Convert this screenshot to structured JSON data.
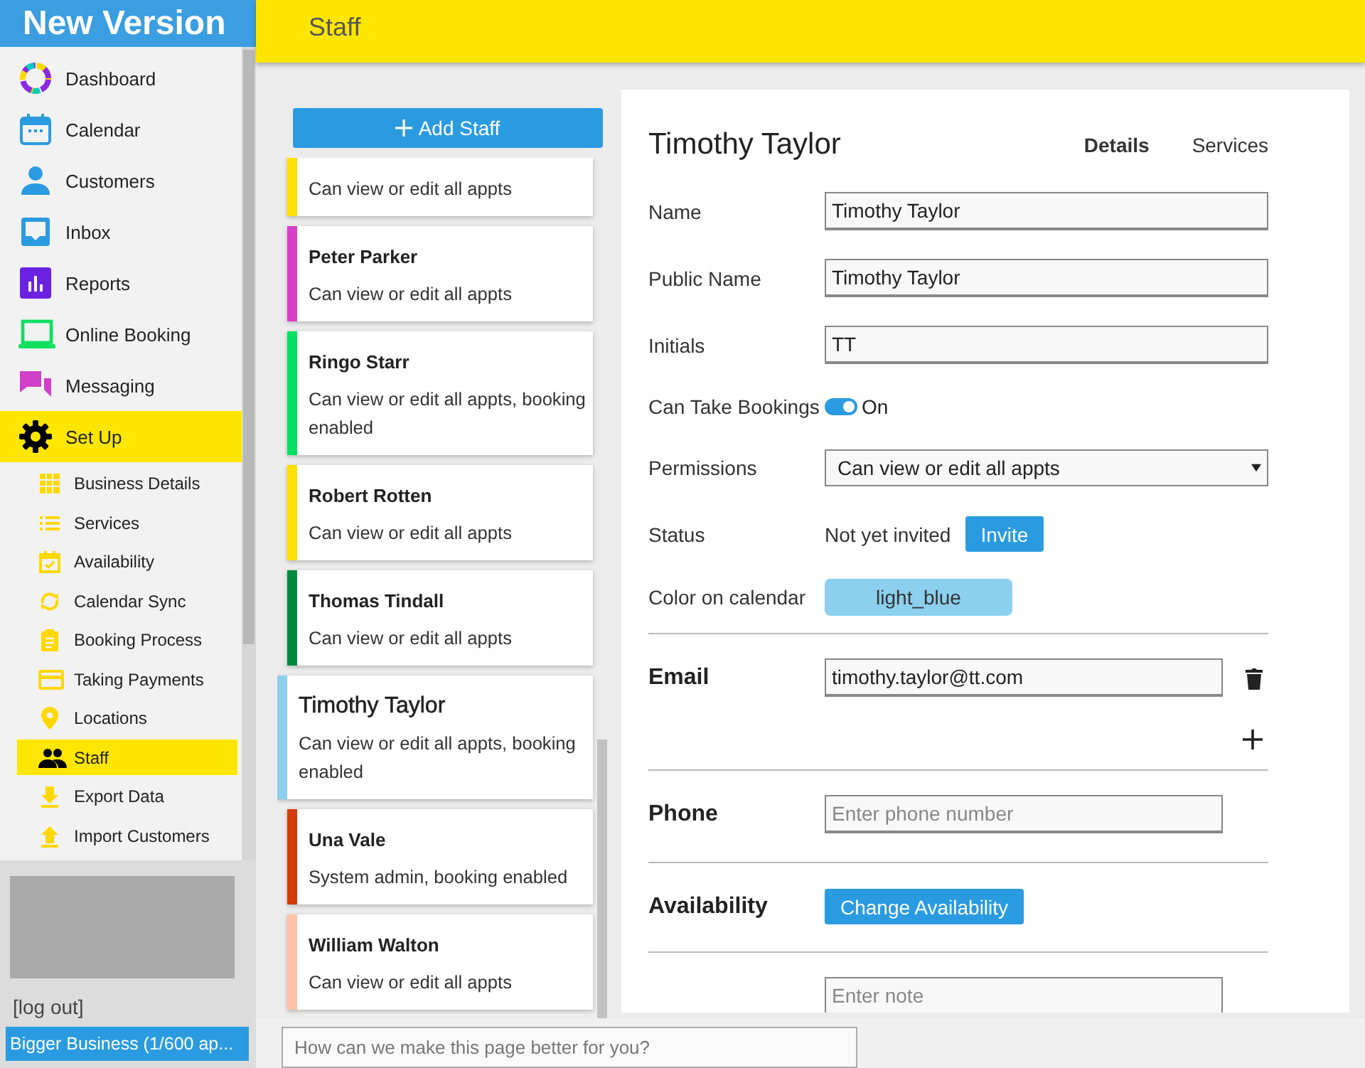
{
  "sidebar": {
    "brand": "New Version",
    "items": [
      {
        "label": "Dashboard",
        "selected": false
      },
      {
        "label": "Calendar",
        "selected": false
      },
      {
        "label": "Customers",
        "selected": false
      },
      {
        "label": "Inbox",
        "selected": false
      },
      {
        "label": "Reports",
        "selected": false
      },
      {
        "label": "Online Booking",
        "selected": false
      },
      {
        "label": "Messaging",
        "selected": false
      },
      {
        "label": "Set Up",
        "selected": true,
        "children": [
          {
            "label": "Business Details",
            "selected": false
          },
          {
            "label": "Services",
            "selected": false
          },
          {
            "label": "Availability",
            "selected": false
          },
          {
            "label": "Calendar Sync",
            "selected": false
          },
          {
            "label": "Booking Process",
            "selected": false
          },
          {
            "label": "Taking Payments",
            "selected": false
          },
          {
            "label": "Locations",
            "selected": false
          },
          {
            "label": "Staff",
            "selected": true
          },
          {
            "label": "Export Data",
            "selected": false
          },
          {
            "label": "Import Customers",
            "selected": false
          }
        ]
      }
    ],
    "logout": "[log out]",
    "account": "Bigger Business (1/600 ap..."
  },
  "top_bar": {
    "title": "Staff"
  },
  "staff": {
    "add_button": "Add Staff",
    "members": [
      {
        "description": "Can view or edit all appts",
        "color": "#ffe000",
        "selected": false
      },
      {
        "name": "Peter Parker",
        "description": "Can view or edit all appts",
        "color": "#d83fc8",
        "selected": false
      },
      {
        "name": "Ringo Starr",
        "description": "Can view or edit all appts, booking enabled",
        "color": "#00e060",
        "selected": false
      },
      {
        "name": "Robert Rotten",
        "description": "Can view or edit all appts",
        "color": "#ffe000",
        "selected": false
      },
      {
        "name": "Thomas Tindall",
        "description": "Can view or edit all appts",
        "color": "#008a40",
        "selected": false
      },
      {
        "name": "Timothy Taylor",
        "description": "Can view or edit all appts, booking enabled",
        "color": "#8ccfee",
        "selected": true
      },
      {
        "name": "Una Vale",
        "description": "System admin, booking enabled",
        "color": "#d33b08",
        "selected": false
      },
      {
        "name": "William Walton",
        "description": "Can view or edit all appts",
        "color": "#ffc2a8",
        "selected": false
      }
    ]
  },
  "detail": {
    "title": "Timothy Taylor",
    "tabs": [
      {
        "label": "Details",
        "selected": true
      },
      {
        "label": "Services",
        "selected": false
      }
    ],
    "name": {
      "label": "Name",
      "value": "Timothy Taylor"
    },
    "public_name": {
      "label": "Public Name",
      "value": "Timothy Taylor"
    },
    "initials": {
      "label": "Initials",
      "value": "TT"
    },
    "can_take_bookings": {
      "label": "Can Take Bookings",
      "on": true,
      "state_text": "On"
    },
    "permissions": {
      "label": "Permissions",
      "value": "Can view or edit all appts"
    },
    "status": {
      "label": "Status",
      "value": "Not yet invited",
      "button": "Invite"
    },
    "calendar_color": {
      "label": "Color on calendar",
      "value": "light_blue",
      "color": "#8ccfee"
    },
    "email": {
      "label": "Email",
      "value": "timothy.taylor@tt.com"
    },
    "phone": {
      "label": "Phone",
      "placeholder": "Enter phone number"
    },
    "availability": {
      "label": "Availability",
      "button": "Change Availability"
    },
    "note": {
      "placeholder": "Enter note"
    }
  },
  "feedback": {
    "placeholder": "How can we make this page better for you?"
  }
}
